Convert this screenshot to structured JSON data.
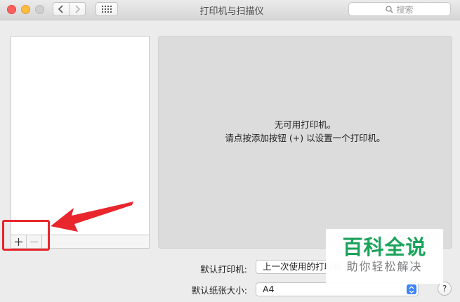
{
  "window": {
    "title": "打印机与扫描仪"
  },
  "search": {
    "placeholder": "搜索"
  },
  "printer_list": {
    "add_label": "+",
    "remove_label": "−"
  },
  "detail": {
    "empty_line1": "无可用打印机。",
    "empty_line2": "请点按添加按钮 (+) 以设置一个打印机。"
  },
  "form": {
    "default_printer_label": "默认打印机:",
    "default_printer_value": "上一次使用的打印机",
    "default_paper_label": "默认纸张大小:",
    "default_paper_value": "A4"
  },
  "help": {
    "label": "?"
  },
  "watermark": {
    "main": "百科全说",
    "sub": "助你轻松解决"
  },
  "colors": {
    "annotation": "#e8262c",
    "accent": "#3d84f5",
    "watermark": "#1aa35a"
  },
  "icons": [
    "close-icon",
    "minimize-icon",
    "zoom-icon",
    "chevron-left-icon",
    "chevron-right-icon",
    "grid-icon",
    "search-icon",
    "chevron-updown-icon",
    "arrow-annotation"
  ]
}
